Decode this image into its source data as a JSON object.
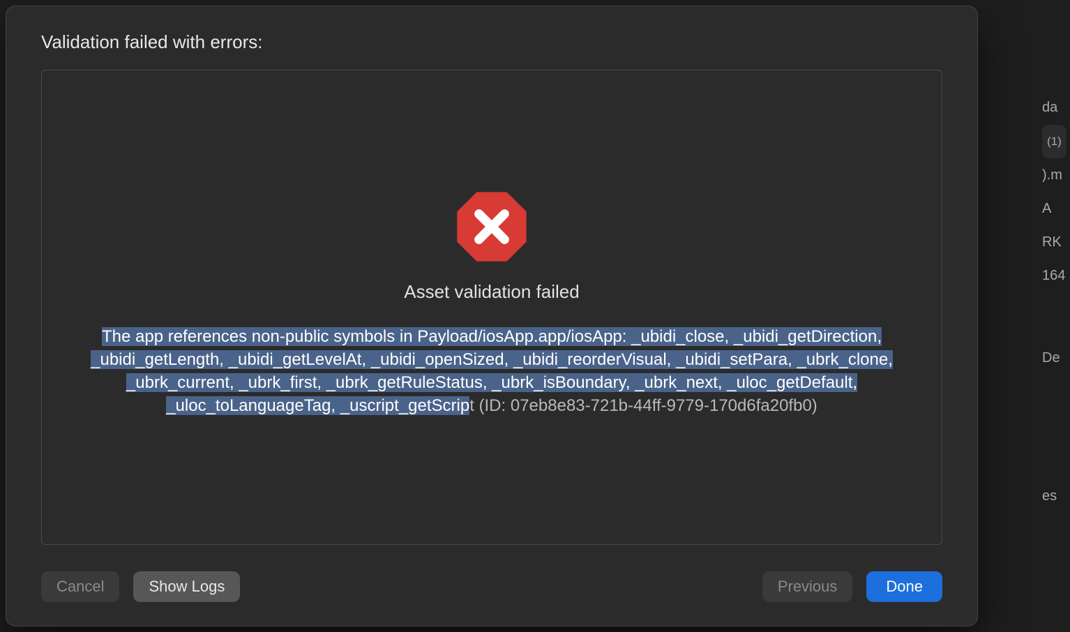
{
  "dialog": {
    "title": "Validation failed with errors:",
    "error_heading": "Asset validation failed",
    "error_body_highlighted": "The app references non-public symbols in Payload/iosApp.app/iosApp: _ubidi_close, _ubidi_getDirection, _ubidi_getLength, _ubidi_getLevelAt, _ubidi_openSized, _ubidi_reorderVisual, _ubidi_setPara, _ubrk_clone, _ubrk_current, _ubrk_first, _ubrk_getRuleStatus, _ubrk_isBoundary, _ubrk_next, _uloc_getDefault, _uloc_toLanguageTag, _uscript_getScrip",
    "error_body_rest": "t (ID: 07eb8e83-721b-44ff-9779-170d6fa20fb0)",
    "buttons": {
      "cancel": "Cancel",
      "show_logs": "Show Logs",
      "previous": "Previous",
      "done": "Done"
    }
  },
  "background": {
    "badge": "(1)",
    "fragments": [
      "da",
      ").m",
      " A",
      "RK",
      "164",
      "De",
      "es"
    ]
  }
}
